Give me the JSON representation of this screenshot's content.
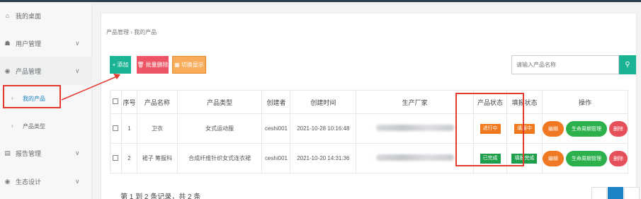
{
  "sidebar": {
    "items": [
      {
        "label": "我的桌面",
        "icon": "home-icon"
      },
      {
        "label": "用户管理",
        "icon": "users-icon"
      },
      {
        "label": "产品管理",
        "icon": "product-icon"
      },
      {
        "label": "报告管理",
        "icon": "report-icon"
      },
      {
        "label": "生态设计",
        "icon": "eco-icon"
      }
    ],
    "sub_items": [
      {
        "label": "我的产品"
      },
      {
        "label": "产品类型"
      }
    ]
  },
  "breadcrumb": "产品管理 › 我的产品",
  "toolbar": {
    "add_label": "添加",
    "batch_delete_label": "批量删除",
    "toggle_label": "切换显示"
  },
  "search": {
    "placeholder": "请输入产品名称"
  },
  "table": {
    "headers": [
      "序号",
      "产品名称",
      "产品类型",
      "创建者",
      "创建时间",
      "生产厂家",
      "产品状态",
      "填报状态",
      "操作"
    ],
    "rows": [
      {
        "index": "1",
        "name": "卫衣",
        "type": "女式运动服",
        "creator": "ceshi001",
        "created": "2021-10-28 10:16:48",
        "product_status": "进行中",
        "fill_status": "填报中"
      },
      {
        "index": "2",
        "name": "裙子 筹服科",
        "type": "合成纤维针织女式连衣裙",
        "creator": "ceshi001",
        "created": "2021-10-20 14:31:36",
        "product_status": "已完成",
        "fill_status": "填报完成"
      }
    ],
    "actions": {
      "edit": "编辑",
      "lifecycle": "生命周期管理",
      "delete": "删除"
    }
  },
  "footer": {
    "summary": "第 1 到 2 条记录，共 2 条"
  },
  "colors": {
    "accent": "#1ab394",
    "highlight": "#e23a2f",
    "in_progress": "#f0781d",
    "done": "#1c9e4a"
  }
}
